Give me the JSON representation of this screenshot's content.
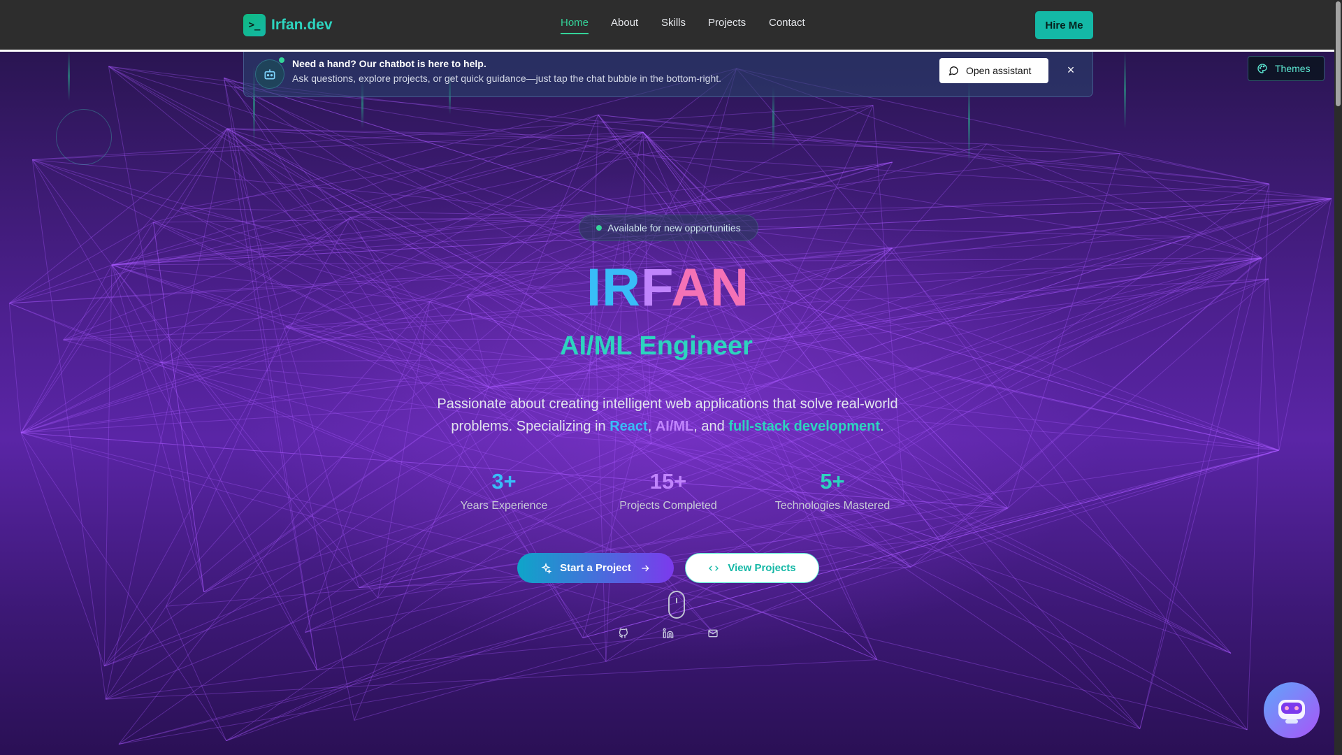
{
  "brand": {
    "name": "Irfan.dev",
    "icon": "terminal-icon"
  },
  "nav": {
    "items": [
      {
        "label": "Home",
        "active": true
      },
      {
        "label": "About",
        "active": false
      },
      {
        "label": "Skills",
        "active": false
      },
      {
        "label": "Projects",
        "active": false
      },
      {
        "label": "Contact",
        "active": false
      }
    ],
    "hire_label": "Hire Me"
  },
  "banner": {
    "title": "Need a hand? Our chatbot is here to help.",
    "subtitle": "Ask questions, explore projects, or get quick guidance—just tap the chat bubble in the bottom-right.",
    "assistant_label": "Open assistant",
    "close_glyph": "×"
  },
  "themes": {
    "label": "Themes"
  },
  "hero": {
    "badge": "Available for new opportunities",
    "name_parts": [
      "IR",
      "F",
      "AN"
    ],
    "role": "AI/ML Engineer",
    "desc_before": "Passionate about creating intelligent web applications that solve real-world problems. Specializing in ",
    "desc_react": "React",
    "desc_comma": ", ",
    "desc_ai": "AI/ML",
    "desc_and": ", and ",
    "desc_full": "full-stack development",
    "desc_end": "."
  },
  "stats": [
    {
      "value": "3+",
      "label": "Years Experience",
      "color": "#38bdf8"
    },
    {
      "value": "15+",
      "label": "Projects Completed",
      "color": "#c084fc"
    },
    {
      "value": "5+",
      "label": "Technologies Mastered",
      "color": "#2dd4bf"
    }
  ],
  "cta": {
    "start_label": "Start a Project",
    "view_label": "View Projects"
  },
  "social": [
    "github-icon",
    "linkedin-icon",
    "mail-icon"
  ],
  "colors": {
    "accent": "#14b8a6",
    "bg_purple": "#5a25a6",
    "nav_bg": "#2d2d2d"
  }
}
